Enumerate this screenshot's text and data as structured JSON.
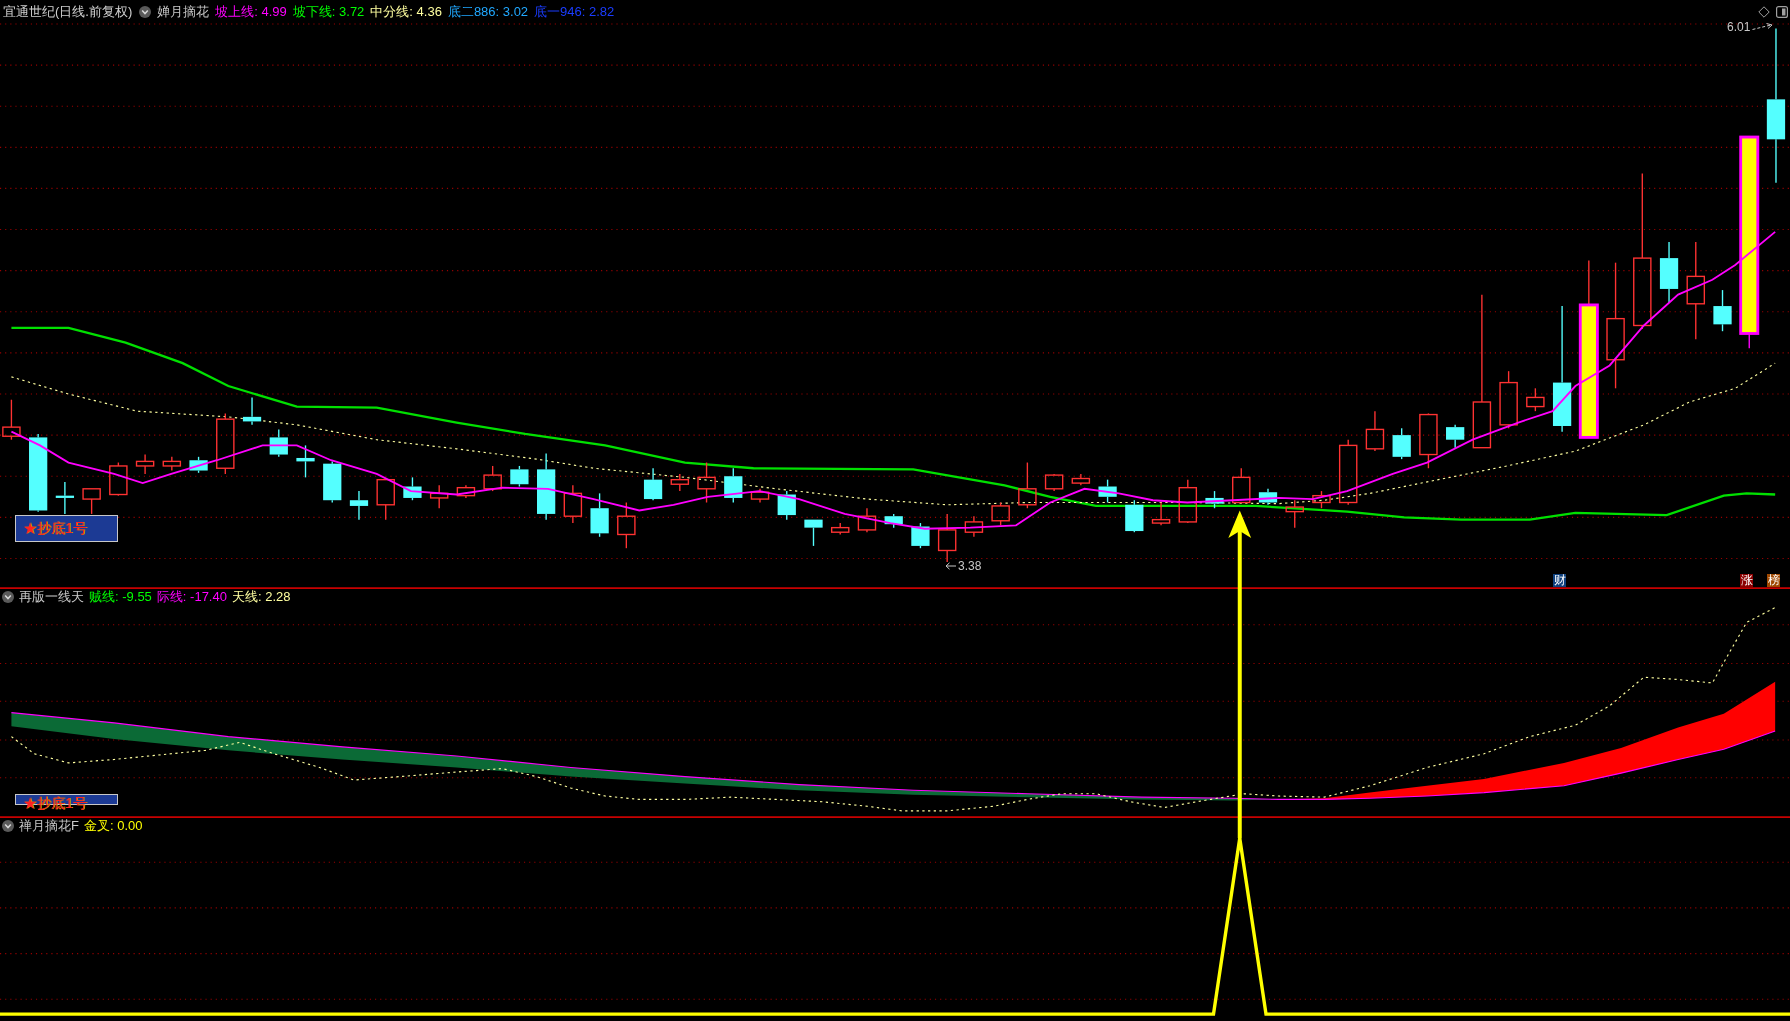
{
  "main_panel": {
    "header": {
      "symbol": "宜通世纪(日线.前复权)",
      "indicator": "婵月摘花",
      "readings": [
        {
          "text": "坡上线: 4.99",
          "color": "#ff00ff"
        },
        {
          "text": "坡下线: 3.72",
          "color": "#00ff00"
        },
        {
          "text": "中分线: 4.36",
          "color": "#ffffa0"
        },
        {
          "text": "底二886: 3.02",
          "color": "#20a8ff"
        },
        {
          "text": "底一946: 2.82",
          "color": "#1a3cff"
        }
      ]
    },
    "high_label": "6.01",
    "low_label": "3.38",
    "signal_label": "★抄底1号",
    "markers": [
      {
        "text": "财",
        "color": "#0d3f7c"
      },
      {
        "text": "涨",
        "color": "#8b0000"
      },
      {
        "text": "榜",
        "color": "#a04800"
      }
    ]
  },
  "middle_panel": {
    "header": {
      "indicator": "再版一线天",
      "readings": [
        {
          "text": "贼线: -9.55",
          "color": "#00ff00"
        },
        {
          "text": "际线: -17.40",
          "color": "#ff00ff"
        },
        {
          "text": "天线: 2.28",
          "color": "#ffffa0"
        }
      ]
    },
    "signal_label": "★抄底1号"
  },
  "bottom_panel": {
    "header": {
      "indicator": "禅月摘花F",
      "readings": [
        {
          "text": "金叉: 0.00",
          "color": "#ffff00"
        }
      ]
    }
  }
}
